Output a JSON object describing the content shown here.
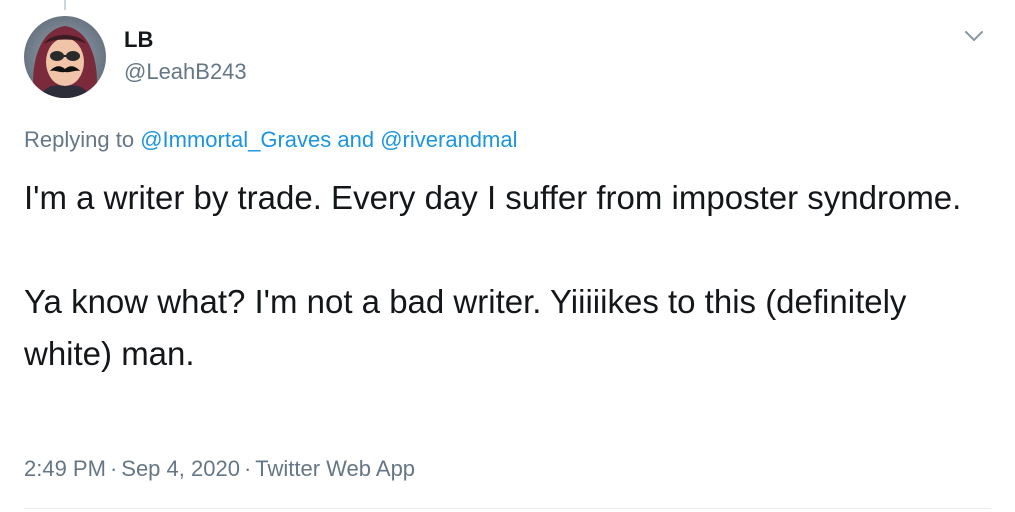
{
  "tweet": {
    "author": {
      "name": "LB",
      "handle": "@LeahB243"
    },
    "replying": {
      "prefix": "Replying to",
      "mention_1": "@Immortal_Graves",
      "conjunction": "and",
      "mention_2": "@riverandmal"
    },
    "text": {
      "paragraph_1": "I'm a writer by trade. Every day I suffer from imposter syndrome.",
      "paragraph_2": "Ya know what? I'm not a bad writer. Yiiiiikes to this (definitely white) man."
    },
    "meta": {
      "time": "2:49 PM",
      "date": "Sep 4, 2020",
      "source": "Twitter Web App",
      "separator": "·"
    }
  },
  "colors": {
    "text": "#14171a",
    "secondary": "#657786",
    "link": "#1b95e0"
  },
  "icons": {
    "more": "chevron-down-icon"
  }
}
